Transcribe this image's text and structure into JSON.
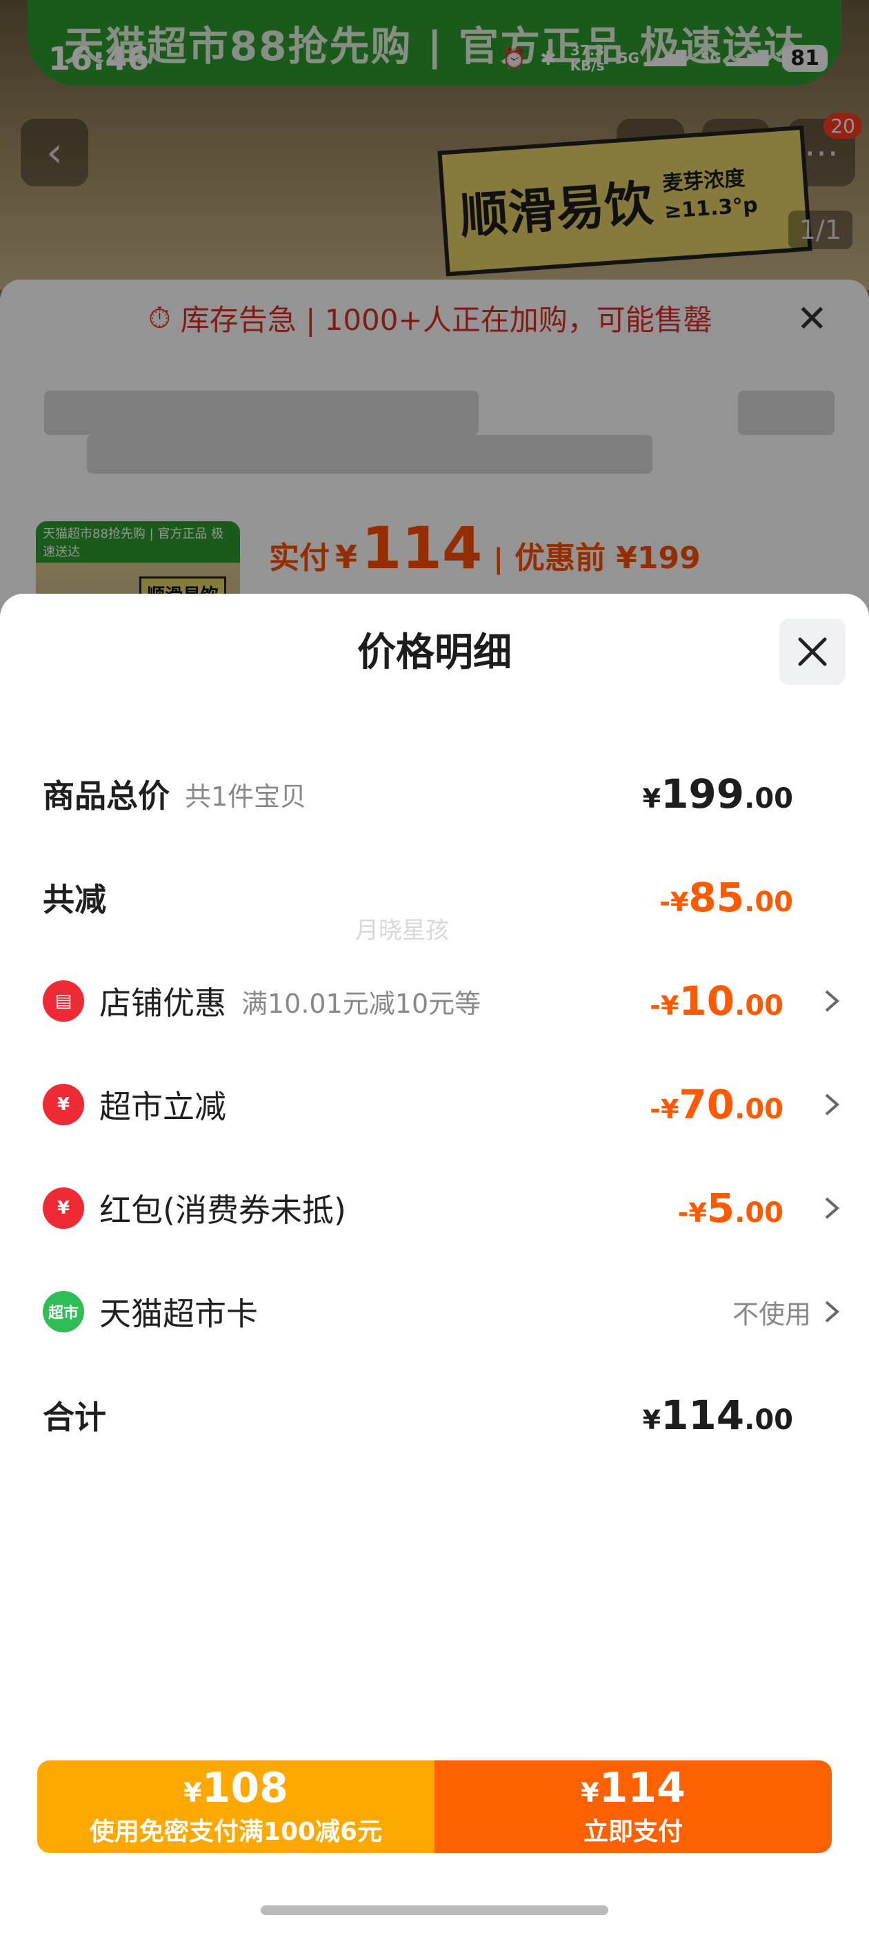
{
  "status_bar": {
    "time": "16:46",
    "net_speed": "37.3",
    "net_unit": "KB/s",
    "sig1": "5G",
    "sig2": "5G",
    "battery": "81"
  },
  "background": {
    "banner": "天猫超市88抢先购 | 官方正品 极速送达",
    "cart_badge": "20",
    "slogan_main": "顺滑易饮",
    "slogan_sub_1": "麦芽浓度",
    "slogan_sub_2": "≥11.3°p",
    "page_counter": "1/1",
    "stock_alert": "库存告急 | 1000+人正在加购，可能售罄",
    "thumb_banner": "天猫超市88抢先购 | 官方正品 极速送达",
    "thumb_label": "顺滑易饮",
    "paid_label": "实付",
    "paid_symbol": "¥",
    "paid_value": "114",
    "before_label": "优惠前 ¥199"
  },
  "modal": {
    "title": "价格明细",
    "watermark": "月晓星孩",
    "rows": {
      "total": {
        "label": "商品总价",
        "sub": "共1件宝贝",
        "sym": "¥",
        "int": "199",
        "dec": ".00"
      },
      "reduce": {
        "label": "共减",
        "sym": "-¥",
        "int": "85",
        "dec": ".00"
      },
      "shop": {
        "label": "店铺优惠",
        "sub": "满10.01元减10元等",
        "sym": "-¥",
        "int": "10",
        "dec": ".00",
        "icon_text": "▤"
      },
      "market": {
        "label": "超市立减",
        "sym": "-¥",
        "int": "70",
        "dec": ".00",
        "icon_text": "¥"
      },
      "redpacket": {
        "label": "红包(消费券未抵)",
        "sym": "-¥",
        "int": "5",
        "dec": ".00",
        "icon_text": "¥"
      },
      "card": {
        "label": "天猫超市卡",
        "value": "不使用",
        "icon_text": "超市"
      },
      "sum": {
        "label": "合计",
        "sym": "¥",
        "int": "114",
        "dec": ".00"
      }
    }
  },
  "paybar": {
    "left": {
      "sym": "¥",
      "amount": "108",
      "text": "使用免密支付满100减6元"
    },
    "right": {
      "sym": "¥",
      "amount": "114",
      "text": "立即支付"
    }
  },
  "colors": {
    "accent_orange": "#ff5a00",
    "pay_left": "#ffa800",
    "pay_right": "#ff6000",
    "banner_green": "#2e9b2e"
  }
}
